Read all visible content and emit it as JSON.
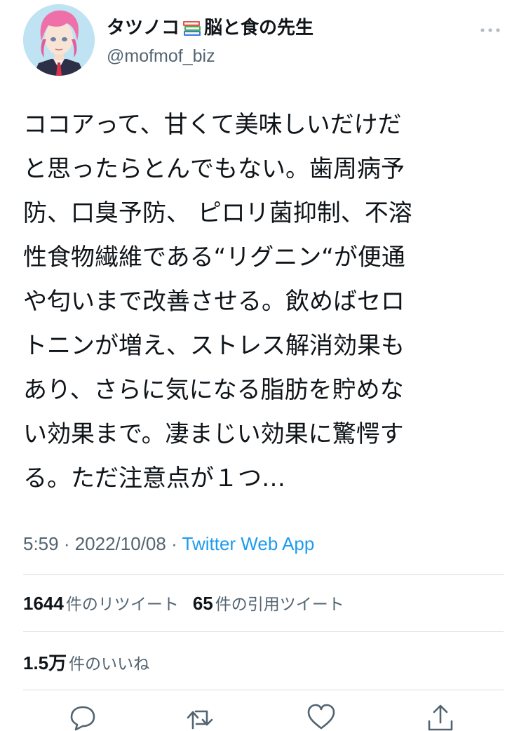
{
  "author": {
    "name_before_icon": "タツノコ",
    "name_icon": "books-icon",
    "name_after_icon": "脳と食の先生",
    "handle": "@mofmof_biz"
  },
  "tweet": {
    "text": "ココアって、甘くて美味しいだけだ\nと思ったらとんでもない。歯周病予\n防、口臭予防、 ピロリ菌抑制、不溶\n性食物繊維である“リグニン“が便通\nや匂いまで改善させる。飲めばセロ\nトニンが増え、ストレス解消効果も\nあり、さらに気になる脂肪を貯めな\nい効果まで。凄まじい効果に驚愕す\nる。ただ注意点が１つ…"
  },
  "meta": {
    "time": "5:59",
    "separator1": " · ",
    "date": "2022/10/08",
    "separator2": " · ",
    "source": "Twitter Web App"
  },
  "stats": {
    "retweets_count": "1644",
    "retweets_label": "件のリツイート",
    "quotes_count": "65",
    "quotes_label": "件の引用ツイート",
    "likes_count": "1.5万",
    "likes_label": "件のいいね"
  },
  "actions": [
    {
      "name": "reply",
      "icon": "reply-icon"
    },
    {
      "name": "retweet",
      "icon": "retweet-icon"
    },
    {
      "name": "like",
      "icon": "heart-icon"
    },
    {
      "name": "share",
      "icon": "share-icon"
    }
  ],
  "colors": {
    "text": "#0f1419",
    "secondary": "#536471",
    "link": "#1d9bf0",
    "divider": "#d9dde0",
    "avatar_bg": "#bfe3f3",
    "hair": "#ef6fa8"
  }
}
